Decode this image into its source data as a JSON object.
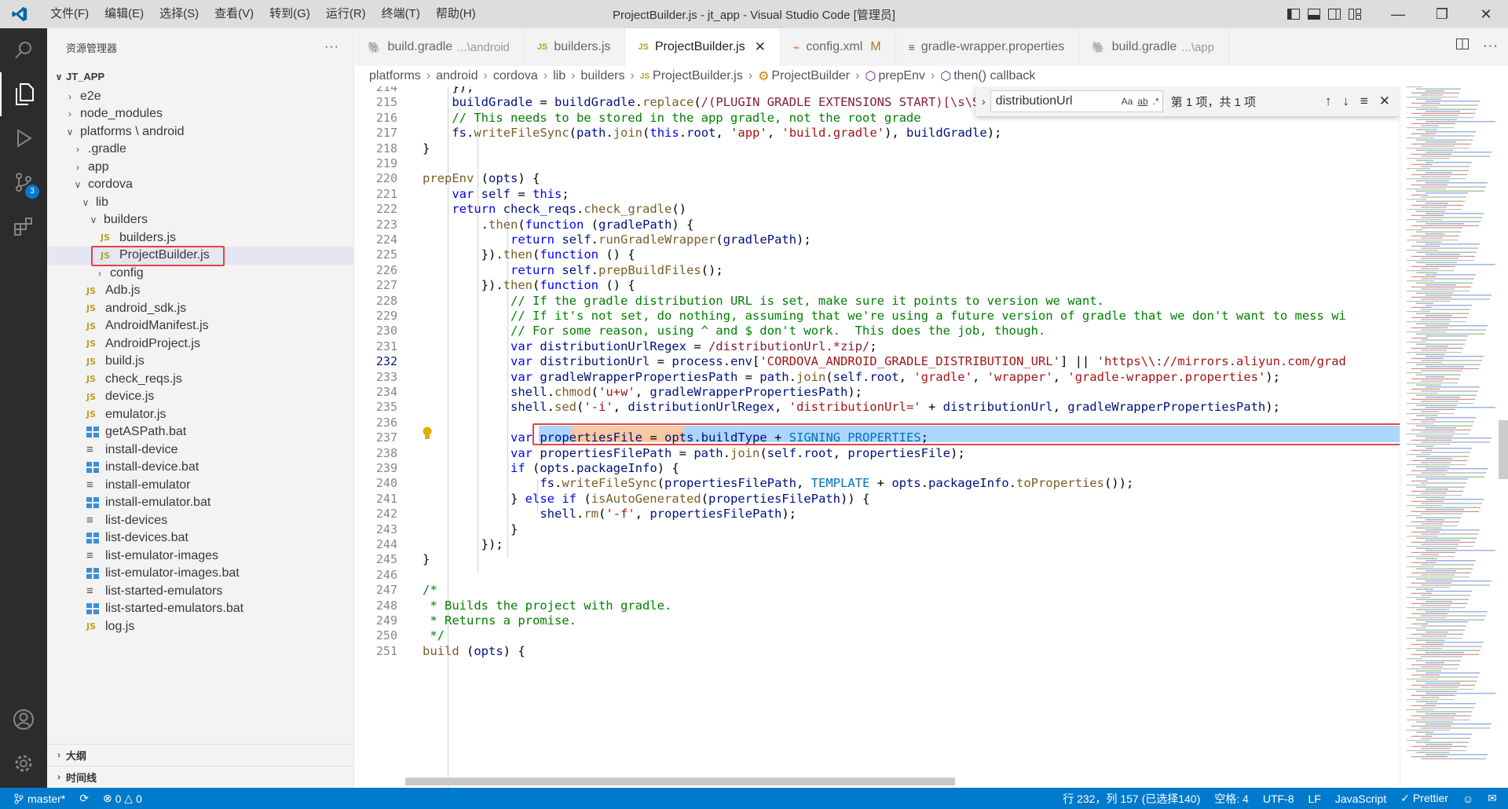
{
  "window": {
    "title": "ProjectBuilder.js - jt_app - Visual Studio Code [管理员]",
    "menu": [
      "文件(F)",
      "编辑(E)",
      "选择(S)",
      "查看(V)",
      "转到(G)",
      "运行(R)",
      "终端(T)",
      "帮助(H)"
    ]
  },
  "activitybar": {
    "scm_badge": "3"
  },
  "sidebar": {
    "title": "资源管理器",
    "more": "···",
    "root": "JT_APP",
    "items": [
      {
        "label": "e2e",
        "type": "folder",
        "open": false
      },
      {
        "label": "node_modules",
        "type": "folder",
        "open": false
      },
      {
        "label": "platforms \\ android",
        "type": "folder",
        "open": true
      },
      {
        "label": ".gradle",
        "type": "folder",
        "open": false
      },
      {
        "label": "app",
        "type": "folder",
        "open": false
      },
      {
        "label": "cordova",
        "type": "folder",
        "open": true
      },
      {
        "label": "lib",
        "type": "folder",
        "open": true
      },
      {
        "label": "builders",
        "type": "folder",
        "open": true
      },
      {
        "label": "builders.js",
        "type": "js"
      },
      {
        "label": "ProjectBuilder.js",
        "type": "js",
        "selected": true
      },
      {
        "label": "config",
        "type": "folder",
        "open": false
      },
      {
        "label": "Adb.js",
        "type": "js"
      },
      {
        "label": "android_sdk.js",
        "type": "js"
      },
      {
        "label": "AndroidManifest.js",
        "type": "js"
      },
      {
        "label": "AndroidProject.js",
        "type": "js"
      },
      {
        "label": "build.js",
        "type": "js"
      },
      {
        "label": "check_reqs.js",
        "type": "js"
      },
      {
        "label": "device.js",
        "type": "js"
      },
      {
        "label": "emulator.js",
        "type": "js"
      },
      {
        "label": "getASPath.bat",
        "type": "bat"
      },
      {
        "label": "install-device",
        "type": "txt"
      },
      {
        "label": "install-device.bat",
        "type": "bat"
      },
      {
        "label": "install-emulator",
        "type": "txt"
      },
      {
        "label": "install-emulator.bat",
        "type": "bat"
      },
      {
        "label": "list-devices",
        "type": "txt"
      },
      {
        "label": "list-devices.bat",
        "type": "bat"
      },
      {
        "label": "list-emulator-images",
        "type": "txt"
      },
      {
        "label": "list-emulator-images.bat",
        "type": "bat"
      },
      {
        "label": "list-started-emulators",
        "type": "txt"
      },
      {
        "label": "list-started-emulators.bat",
        "type": "bat"
      },
      {
        "label": "log.js",
        "type": "js"
      }
    ],
    "outline": "大纲",
    "timeline": "时间线"
  },
  "tabs": [
    {
      "label": "build.gradle",
      "sub": "...\\android",
      "icon": "gradle"
    },
    {
      "label": "builders.js",
      "icon": "js"
    },
    {
      "label": "ProjectBuilder.js",
      "icon": "js",
      "active": true
    },
    {
      "label": "config.xml",
      "icon": "xml",
      "mod": "M"
    },
    {
      "label": "gradle-wrapper.properties",
      "icon": "props"
    },
    {
      "label": "build.gradle",
      "sub": "...\\app",
      "icon": "gradle"
    }
  ],
  "breadcrumb": [
    "platforms",
    "android",
    "cordova",
    "lib",
    "builders",
    "ProjectBuilder.js",
    "ProjectBuilder",
    "prepEnv",
    "then() callback"
  ],
  "find": {
    "query": "distributionUrl",
    "case": "Aa",
    "word": "ab",
    "regex": ".*",
    "result": "第 1 项，共 1 项"
  },
  "editor": {
    "current_line": 232,
    "line_numbers": [
      "214",
      "215",
      "216",
      "217",
      "218",
      "219",
      "220",
      "221",
      "222",
      "223",
      "224",
      "225",
      "226",
      "227",
      "228",
      "229",
      "230",
      "231",
      "232",
      "233",
      "234",
      "235",
      "236",
      "237",
      "238",
      "239",
      "240",
      "241",
      "242",
      "243",
      "244",
      "245",
      "246",
      "247",
      "248",
      "249",
      "250",
      "251"
    ]
  },
  "status": {
    "branch": "master*",
    "errors": "0",
    "warnings": "0",
    "position": "行 232，列 157 (已选择140)",
    "indent": "空格: 4",
    "encoding": "UTF-8",
    "eol": "LF",
    "language": "JavaScript",
    "prettier": "✓ Prettier"
  }
}
